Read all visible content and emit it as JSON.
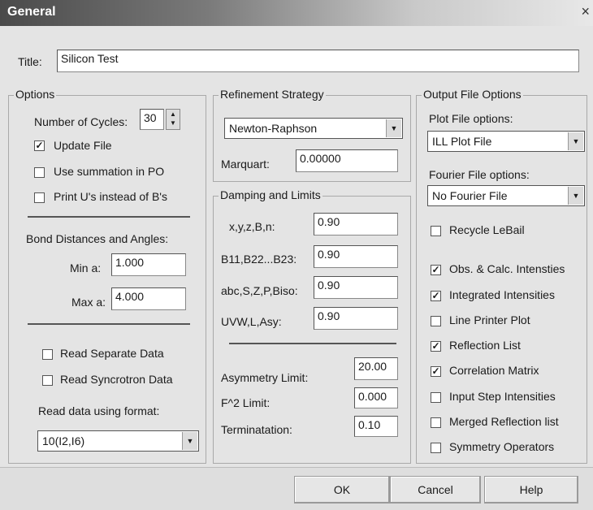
{
  "window": {
    "title": "General",
    "close": "×"
  },
  "title_field": {
    "label": "Title:",
    "value": "Silicon Test"
  },
  "options": {
    "heading": "Options",
    "cycles_label": "Number of Cycles:",
    "cycles_value": "30",
    "update_file": {
      "label": "Update File",
      "checked": true
    },
    "use_summation": {
      "label": "Use summation in PO",
      "checked": false
    },
    "print_u": {
      "label": "Print U's instead of B's",
      "checked": false
    },
    "bond_heading": "Bond Distances and Angles:",
    "min_label": "Min a:",
    "min_value": "1.000",
    "max_label": "Max a:",
    "max_value": "4.000",
    "read_separate": {
      "label": "Read Separate Data",
      "checked": false
    },
    "read_syncrotron": {
      "label": "Read Syncrotron Data",
      "checked": false
    },
    "format_label": "Read data using format:",
    "format_value": "10(I2,I6)"
  },
  "refinement": {
    "heading": "Refinement Strategy",
    "strategy": "Newton-Raphson",
    "marquart_label": "Marquart:",
    "marquart_value": "0.00000"
  },
  "damping": {
    "heading": "Damping and Limits",
    "rows": [
      {
        "label": "x,y,z,B,n:",
        "value": "0.90"
      },
      {
        "label": "B11,B22...B23:",
        "value": "0.90"
      },
      {
        "label": "abc,S,Z,P,Biso:",
        "value": "0.90"
      },
      {
        "label": "UVW,L,Asy:",
        "value": "0.90"
      }
    ],
    "asym_label": "Asymmetry Limit:",
    "asym_value": "20.00",
    "f2_label": "F^2 Limit:",
    "f2_value": "0.000",
    "term_label": "Terminatation:",
    "term_value": "0.10"
  },
  "output": {
    "heading": "Output File Options",
    "plot_label": "Plot File options:",
    "plot_value": "ILL Plot File",
    "fourier_label": "Fourier File options:",
    "fourier_value": "No Fourier File",
    "checks": [
      {
        "label": "Recycle LeBail",
        "checked": false
      },
      {
        "label": "Obs. & Calc. Intensties",
        "checked": true
      },
      {
        "label": "Integrated Intensities",
        "checked": true
      },
      {
        "label": "Line Printer Plot",
        "checked": false
      },
      {
        "label": "Reflection List",
        "checked": true
      },
      {
        "label": "Correlation Matrix",
        "checked": true
      },
      {
        "label": "Input Step Intensities",
        "checked": false
      },
      {
        "label": "Merged Reflection list",
        "checked": false
      },
      {
        "label": "Symmetry Operators",
        "checked": false
      }
    ]
  },
  "buttons": {
    "ok": "OK",
    "cancel": "Cancel",
    "help": "Help"
  },
  "glyphs": {
    "check": "✓",
    "down": "▼",
    "up": "▲"
  }
}
